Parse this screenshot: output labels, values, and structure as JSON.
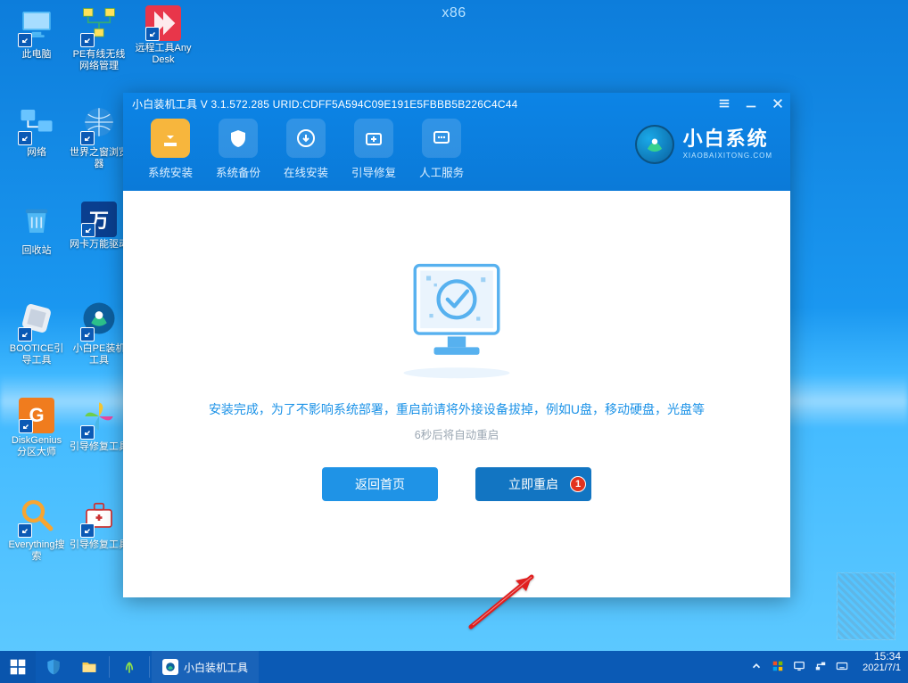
{
  "arch_label": "x86",
  "desktop_icons": [
    {
      "id": "this-pc",
      "label": "此电脑"
    },
    {
      "id": "pe-net",
      "label": "PE有线无线网络管理"
    },
    {
      "id": "anydesk",
      "label": "远程工具AnyDesk"
    },
    {
      "id": "network",
      "label": "网络"
    },
    {
      "id": "world-browser",
      "label": "世界之窗浏览器"
    },
    {
      "id": "recycle",
      "label": "回收站"
    },
    {
      "id": "wan-driver",
      "label": "网卡万能驱动"
    },
    {
      "id": "bootice",
      "label": "BOOTICE引导工具"
    },
    {
      "id": "xiaobai-pe",
      "label": "小白PE装机工具"
    },
    {
      "id": "diskgenius",
      "label": "DiskGenius分区大师"
    },
    {
      "id": "boot-repair",
      "label": "引导修复工具"
    },
    {
      "id": "everything",
      "label": "Everything搜索"
    },
    {
      "id": "boot-repair2",
      "label": "引导修复工具"
    }
  ],
  "app": {
    "title": "小白装机工具 V 3.1.572.285 URID:CDFF5A594C09E191E5FBBB5B226C4C44",
    "tabs": [
      {
        "id": "install",
        "label": "系统安装",
        "active": true
      },
      {
        "id": "backup",
        "label": "系统备份"
      },
      {
        "id": "online",
        "label": "在线安装"
      },
      {
        "id": "bootfix",
        "label": "引导修复"
      },
      {
        "id": "service",
        "label": "人工服务"
      }
    ],
    "brand_zh": "小白系统",
    "brand_en": "XIAOBAIXITONG.COM",
    "message_primary": "安装完成，为了不影响系统部署，重启前请将外接设备拔掉，例如U盘，移动硬盘，光盘等",
    "message_secondary": "6秒后将自动重启",
    "btn_back": "返回首页",
    "btn_restart": "立即重启",
    "badge_number": "1"
  },
  "taskbar": {
    "task_label": "小白装机工具",
    "time": "15:34",
    "date": "2021/7/1"
  },
  "tray_icons": [
    "chevron",
    "flag",
    "monitor",
    "network",
    "keyboard"
  ]
}
